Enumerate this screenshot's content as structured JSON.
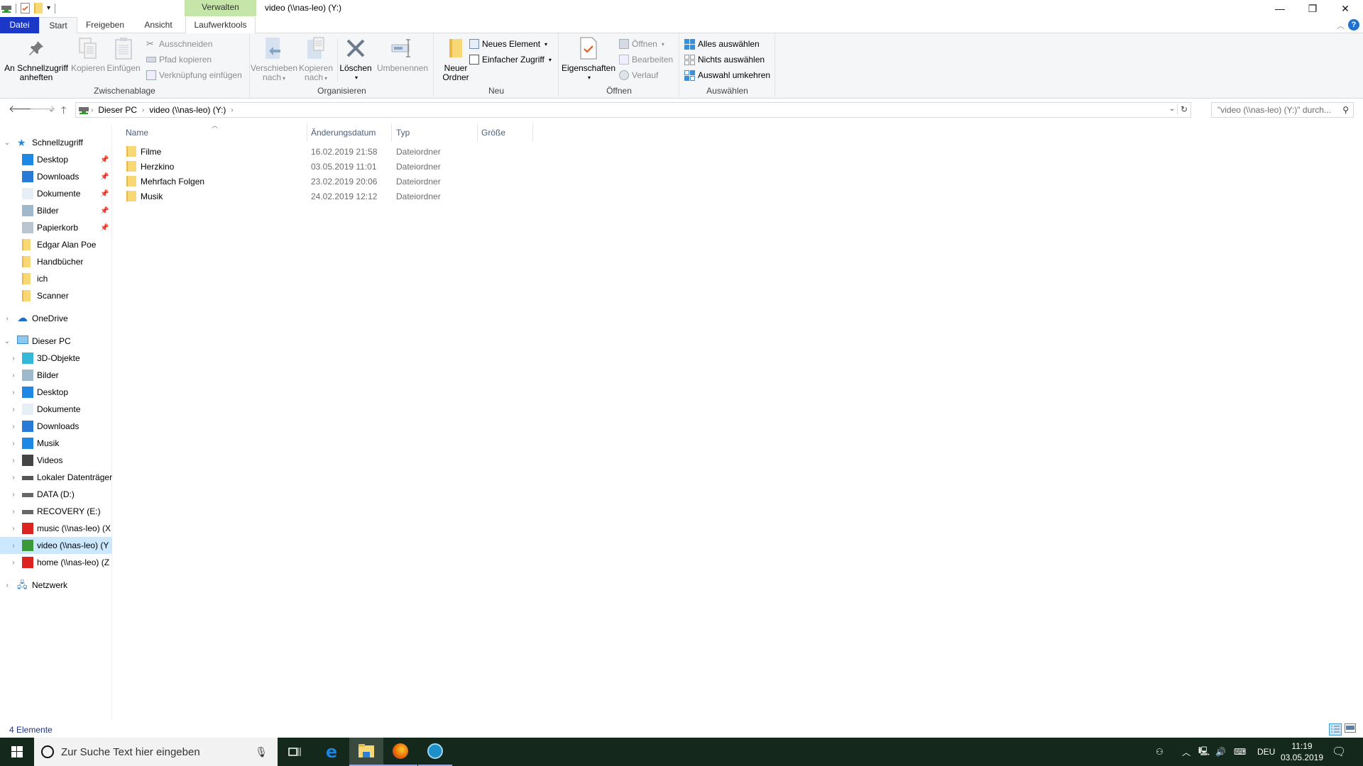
{
  "window": {
    "title": "video (\\\\nas-leo) (Y:)",
    "context_tab_group": "Verwalten",
    "controls": {
      "minimize": "—",
      "restore": "❐",
      "close": "✕"
    }
  },
  "quick_access_toolbar": [
    "drive-icon",
    "properties-icon",
    "new-folder-icon",
    "customize-dropdown"
  ],
  "ribbon_tabs": [
    {
      "label": "Datei",
      "active": false
    },
    {
      "label": "Start",
      "active": true
    },
    {
      "label": "Freigeben",
      "active": false
    },
    {
      "label": "Ansicht",
      "active": false
    },
    {
      "label": "Laufwerktools",
      "active": false
    }
  ],
  "ribbon": {
    "groups": {
      "clipboard": {
        "label": "Zwischenablage",
        "pin": "An Schnellzugriff anheften",
        "pin_line1": "An Schnellzugriff",
        "pin_line2": "anheften",
        "copy": "Kopieren",
        "paste": "Einfügen",
        "cut": "Ausschneiden",
        "copy_path": "Pfad kopieren",
        "paste_shortcut": "Verknüpfung einfügen"
      },
      "organize": {
        "label": "Organisieren",
        "move_line1": "Verschieben",
        "move_line2": "nach",
        "copyto_line1": "Kopieren",
        "copyto_line2": "nach",
        "delete": "Löschen",
        "rename": "Umbenennen"
      },
      "new": {
        "label": "Neu",
        "new_folder_line1": "Neuer",
        "new_folder_line2": "Ordner",
        "new_item": "Neues Element",
        "easy_access": "Einfacher Zugriff"
      },
      "open": {
        "label": "Öffnen",
        "properties": "Eigenschaften",
        "open": "Öffnen",
        "edit": "Bearbeiten",
        "history": "Verlauf"
      },
      "select": {
        "label": "Auswählen",
        "select_all": "Alles auswählen",
        "select_none": "Nichts auswählen",
        "invert": "Auswahl umkehren"
      }
    }
  },
  "address_bar": {
    "breadcrumbs": [
      "Dieser PC",
      "video (\\\\nas-leo) (Y:)"
    ],
    "search_placeholder": "\"video (\\\\nas-leo) (Y:)\" durch..."
  },
  "nav_pane": {
    "quick_access": {
      "label": "Schnellzugriff",
      "items": [
        {
          "label": "Desktop",
          "icon": "desktop-icon",
          "pinned": true
        },
        {
          "label": "Downloads",
          "icon": "downloads-icon",
          "pinned": true
        },
        {
          "label": "Dokumente",
          "icon": "documents-icon",
          "pinned": true
        },
        {
          "label": "Bilder",
          "icon": "pictures-icon",
          "pinned": true
        },
        {
          "label": "Papierkorb",
          "icon": "recycle-bin-icon",
          "pinned": true
        },
        {
          "label": "Edgar Alan Poe",
          "icon": "folder-icon",
          "pinned": false
        },
        {
          "label": "Handbücher",
          "icon": "folder-icon",
          "pinned": false
        },
        {
          "label": "ich",
          "icon": "folder-icon",
          "pinned": false
        },
        {
          "label": "Scanner",
          "icon": "folder-icon",
          "pinned": false
        }
      ]
    },
    "onedrive": {
      "label": "OneDrive"
    },
    "this_pc": {
      "label": "Dieser PC",
      "items": [
        {
          "label": "3D-Objekte",
          "icon": "3d-objects-icon"
        },
        {
          "label": "Bilder",
          "icon": "pictures-icon"
        },
        {
          "label": "Desktop",
          "icon": "desktop-icon"
        },
        {
          "label": "Dokumente",
          "icon": "documents-icon"
        },
        {
          "label": "Downloads",
          "icon": "downloads-icon"
        },
        {
          "label": "Musik",
          "icon": "music-icon"
        },
        {
          "label": "Videos",
          "icon": "videos-icon"
        },
        {
          "label": "Lokaler Datenträger",
          "icon": "system-drive-icon"
        },
        {
          "label": "DATA (D:)",
          "icon": "drive-icon"
        },
        {
          "label": "RECOVERY (E:)",
          "icon": "drive-icon"
        },
        {
          "label": "music (\\\\nas-leo) (X",
          "icon": "network-drive-disconnected-icon"
        },
        {
          "label": "video (\\\\nas-leo) (Y",
          "icon": "network-drive-icon",
          "selected": true
        },
        {
          "label": "home (\\\\nas-leo) (Z",
          "icon": "network-drive-disconnected-icon"
        }
      ]
    },
    "network": {
      "label": "Netzwerk"
    }
  },
  "file_list": {
    "columns": [
      "Name",
      "Änderungsdatum",
      "Typ",
      "Größe"
    ],
    "rows": [
      {
        "name": "Filme",
        "date": "16.02.2019 21:58",
        "type": "Dateiordner",
        "size": ""
      },
      {
        "name": "Herzkino",
        "date": "03.05.2019 11:01",
        "type": "Dateiordner",
        "size": ""
      },
      {
        "name": "Mehrfach Folgen",
        "date": "23.02.2019 20:06",
        "type": "Dateiordner",
        "size": ""
      },
      {
        "name": "Musik",
        "date": "24.02.2019 12:12",
        "type": "Dateiordner",
        "size": ""
      }
    ]
  },
  "status_bar": {
    "item_count": "4 Elemente",
    "view_mode": "details"
  },
  "taskbar": {
    "search_placeholder": "Zur Suche Text hier eingeben",
    "apps": [
      "task-view",
      "edge",
      "file-explorer",
      "firefox",
      "quicktime"
    ],
    "tray": {
      "language": "DEU",
      "time": "11:19",
      "date": "03.05.2019"
    }
  }
}
